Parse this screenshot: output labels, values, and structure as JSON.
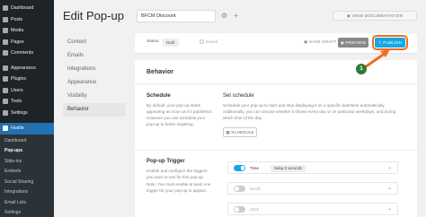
{
  "wp_menu": {
    "items": [
      {
        "label": "Dashboard",
        "icon": "dashboard-icon"
      },
      {
        "label": "Posts",
        "icon": "pin-icon"
      },
      {
        "label": "Media",
        "icon": "media-icon"
      },
      {
        "label": "Pages",
        "icon": "page-icon"
      },
      {
        "label": "Comments",
        "icon": "comment-icon"
      },
      {
        "label": "Appearance",
        "icon": "brush-icon"
      },
      {
        "label": "Plugins",
        "icon": "plugin-icon"
      },
      {
        "label": "Users",
        "icon": "user-icon"
      },
      {
        "label": "Tools",
        "icon": "wrench-icon"
      },
      {
        "label": "Settings",
        "icon": "settings-icon"
      },
      {
        "label": "Hustle",
        "icon": "hustle-icon"
      }
    ],
    "submenu": [
      "Dashboard",
      "Pop-ups",
      "Slide-ins",
      "Embeds",
      "Social Sharing",
      "Integrations",
      "Email Lists",
      "Settings"
    ]
  },
  "header": {
    "title": "Edit Pop-up",
    "popup_name": "BFCM Discount",
    "view_docs": "VIEW DOCUMENTATION"
  },
  "nav": [
    "Content",
    "Emails",
    "Integrations",
    "Appearance",
    "Visibility",
    "Behavior"
  ],
  "status_bar": {
    "status_label": "Status",
    "status_value": "Draft",
    "saved_text": "Saved",
    "save_draft": "SAVE DRAFT",
    "preview": "PREVIEW",
    "publish": "PUBLISH"
  },
  "annotation": {
    "step": "1",
    "color": "#f36c21"
  },
  "behavior": {
    "title": "Behavior",
    "schedule": {
      "title": "Schedule",
      "desc": "By default, your pop-up starts appearing as soon as it's published. However you can schedule your pop-up to better targeting.",
      "sub_title": "Set schedule",
      "sub_desc": "Schedule your pop-up to start and stop displaying it on a specific date/time automatically. Additionally, you can choose whether it shows every day or on particular weekdays, and during which time of the day.",
      "button": "SCHEDULE"
    },
    "trigger": {
      "title": "Pop-up Trigger",
      "desc": "Enable and configure the triggers you want to use for this pop-up.",
      "note": "Note: You must enable at least one trigger for your pop-up to appear.",
      "items": [
        {
          "label": "Time",
          "on": true,
          "badge": "Delay 3 seconds"
        },
        {
          "label": "Scroll",
          "on": false
        },
        {
          "label": "Click",
          "on": false
        }
      ]
    }
  },
  "colors": {
    "accent": "#17a8e3",
    "wp_active": "#2271b1",
    "sidebar": "#1d2327"
  }
}
